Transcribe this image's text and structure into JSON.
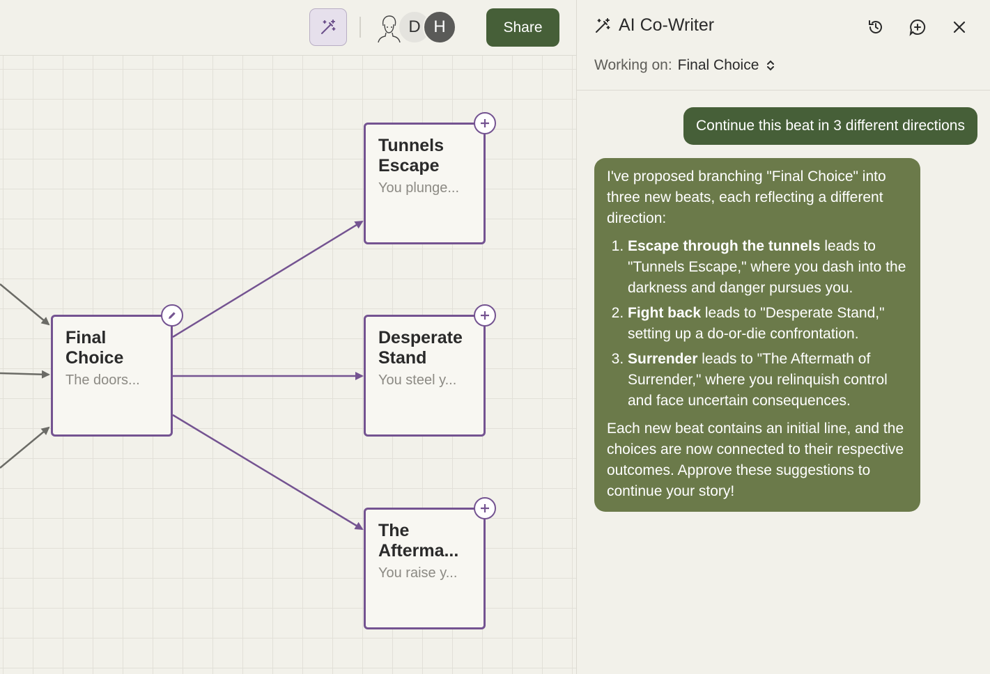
{
  "topbar": {
    "share_label": "Share",
    "avatars": [
      {
        "initial": ""
      },
      {
        "initial": "D"
      },
      {
        "initial": "H"
      }
    ]
  },
  "nodes": [
    {
      "title": "Final\nChoice",
      "excerpt": "The doors..."
    },
    {
      "title": "Tunnels\nEscape",
      "excerpt": "You plunge..."
    },
    {
      "title": "Desperate\nStand",
      "excerpt": "You steel y..."
    },
    {
      "title": "The\nAfterma...",
      "excerpt": "You raise y..."
    }
  ],
  "panel": {
    "title": "AI Co-Writer",
    "working_label": "Working on:",
    "working_value": "Final Choice",
    "user_message": "Continue this beat in 3 different directions",
    "ai_intro": "I've proposed branching \"Final Choice\" into three new beats, each reflecting a different direction:",
    "ai_items": [
      {
        "bold": "Escape through the tunnels",
        "rest": " leads to \"Tunnels Escape,\" where you dash into the darkness and danger pursues you."
      },
      {
        "bold": "Fight back",
        "rest": " leads to \"Desperate Stand,\" setting up a do-or-die confrontation."
      },
      {
        "bold": "Surrender",
        "rest": " leads to \"The Aftermath of Surrender,\" where you relinquish control and face uncertain consequences."
      }
    ],
    "ai_outro": "Each new beat contains an initial line, and the choices are now connected to their respective outcomes. Approve these suggestions to continue your story!"
  },
  "colors": {
    "accent_green": "#465f38",
    "ai_bubble": "#6b7a4a",
    "node_border": "#745391",
    "edge_gray": "#6b6b66"
  }
}
